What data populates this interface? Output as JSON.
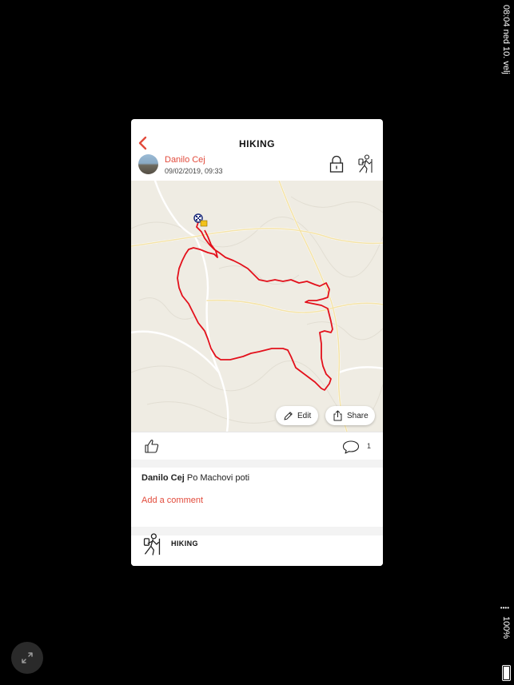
{
  "status_bar": {
    "time_date": "08:04 ned 10. velj",
    "battery_percent": "100%"
  },
  "header": {
    "title": "HIKING",
    "user_name": "Danilo Cej",
    "timestamp": "09/02/2019, 09:33"
  },
  "map": {
    "edit_label": "Edit",
    "share_label": "Share"
  },
  "actions": {
    "comment_count": "1"
  },
  "post": {
    "author": "Danilo Cej",
    "text": "Po Machovi poti",
    "add_comment_label": "Add a comment"
  },
  "activity": {
    "label": "HIKING"
  },
  "colors": {
    "accent": "#e24b3c",
    "route": "#e3101b",
    "map_bg": "#efece3"
  }
}
